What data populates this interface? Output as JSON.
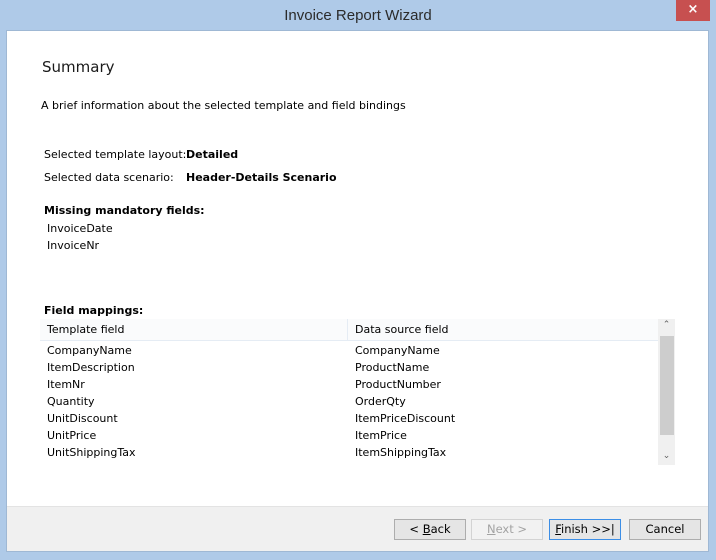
{
  "window": {
    "title": "Invoice Report Wizard",
    "close_icon": "×"
  },
  "page": {
    "heading": "Summary",
    "description": "A brief information about the selected template and field bindings"
  },
  "summary": {
    "template_layout_label": "Selected template layout:",
    "template_layout_value": "Detailed",
    "data_scenario_label": "Selected data scenario:",
    "data_scenario_value": "Header-Details Scenario"
  },
  "missing": {
    "label": "Missing mandatory fields:",
    "items": [
      "InvoiceDate",
      "InvoiceNr"
    ]
  },
  "mappings": {
    "label": "Field mappings:",
    "columns": [
      "Template field",
      "Data source field"
    ],
    "rows": [
      [
        "CompanyName",
        "CompanyName"
      ],
      [
        "ItemDescription",
        "ProductName"
      ],
      [
        "ItemNr",
        "ProductNumber"
      ],
      [
        "Quantity",
        "OrderQty"
      ],
      [
        "UnitDiscount",
        "ItemPriceDiscount"
      ],
      [
        "UnitPrice",
        "ItemPrice"
      ],
      [
        "UnitShippingTax",
        "ItemShippingTax"
      ]
    ]
  },
  "buttons": {
    "back_prefix": "< ",
    "back_key": "B",
    "back_rest": "ack",
    "next_key": "N",
    "next_rest": "ext >",
    "finish_key": "F",
    "finish_rest": "inish >>|",
    "cancel": "Cancel"
  }
}
